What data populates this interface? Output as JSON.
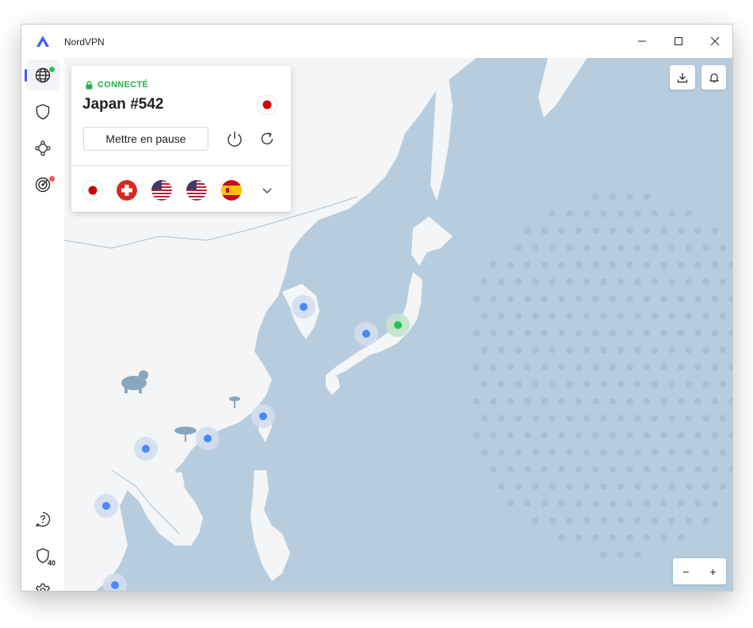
{
  "window": {
    "title": "NordVPN",
    "minimize_icon": "minimize-icon",
    "maximize_icon": "maximize-icon",
    "close_icon": "close-icon"
  },
  "sidebar": {
    "items": [
      {
        "name": "globe-icon",
        "active": true,
        "badge_color": "#23c552"
      },
      {
        "name": "shield-icon",
        "active": false
      },
      {
        "name": "meshnet-icon",
        "active": false
      },
      {
        "name": "radar-icon",
        "active": false,
        "badge_color": "#ff4f4f"
      }
    ],
    "bottom_items": [
      {
        "name": "help-icon"
      },
      {
        "name": "threat-protection-icon",
        "badge": "40"
      },
      {
        "name": "settings-icon"
      }
    ]
  },
  "connection": {
    "status": "CONNECTÉ",
    "status_color": "#22b04a",
    "server": "Japan #542",
    "pause_label": "Mettre en pause",
    "power_icon": "power-icon",
    "reconnect_icon": "reconnect-icon"
  },
  "recent_countries": [
    {
      "name": "japan-flag-icon"
    },
    {
      "name": "switzerland-flag-icon"
    },
    {
      "name": "usa-flag-icon"
    },
    {
      "name": "usa-flag-icon"
    },
    {
      "name": "spain-flag-icon"
    }
  ],
  "toolbar": {
    "download_icon": "download-icon",
    "bell_icon": "bell-icon"
  },
  "zoom": {
    "minus_label": "−",
    "plus_label": "+"
  },
  "colors": {
    "accent": "#3e5fff",
    "map_water": "#b7cddd",
    "map_land": "#f4f5f6",
    "server_pin": "#4a8af4",
    "connected_pin": "#23c552"
  }
}
